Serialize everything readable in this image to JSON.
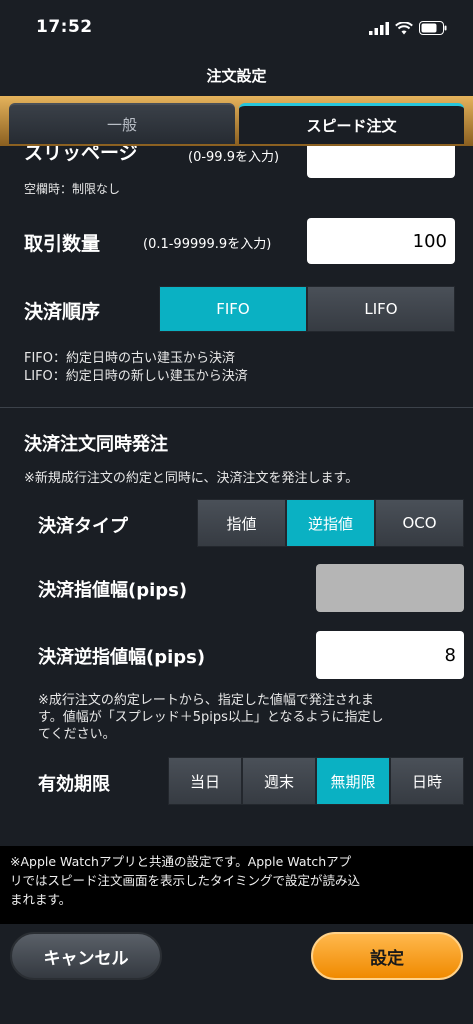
{
  "status": {
    "time": "17:52"
  },
  "title": "注文設定",
  "tabs": [
    {
      "label": "一般"
    },
    {
      "label": "スピード注文"
    }
  ],
  "slippage": {
    "label": "スリッページ",
    "hint": "(0-99.9を入力)",
    "note": "空欄時：制限なし",
    "value": ""
  },
  "quantity": {
    "label": "取引数量",
    "hint": "(0.1-99999.9を入力)",
    "value": "100"
  },
  "settlement_order": {
    "label": "決済順序",
    "options": [
      "FIFO",
      "LIFO"
    ],
    "selected": "FIFO",
    "notes": [
      "FIFO：約定日時の古い建玉から決済",
      "LIFO：約定日時の新しい建玉から決済"
    ]
  },
  "simultaneous": {
    "title": "決済注文同時発注",
    "note": "※新規成行注文の約定と同時に、決済注文を発注します。"
  },
  "settlement_type": {
    "label": "決済タイプ",
    "options": [
      "指値",
      "逆指値",
      "OCO"
    ],
    "selected": "逆指値"
  },
  "limit_width": {
    "label": "決済指値幅(pips)",
    "value": ""
  },
  "stop_width": {
    "label": "決済逆指値幅(pips)",
    "value": "8"
  },
  "width_note": [
    "※成行注文の約定レートから、指定した値幅で発注されま",
    "す。値幅が「スプレッド＋5pips以上」となるように指定し",
    "てください。"
  ],
  "expiry": {
    "label": "有効期限",
    "options": [
      "当日",
      "週末",
      "無期限",
      "日時"
    ],
    "selected": "無期限"
  },
  "footer_note": [
    "※Apple Watchアプリと共通の設定です。Apple Watchアプ",
    "リではスピード注文画面を表示したタイミングで設定が読み込",
    "まれます。"
  ],
  "buttons": {
    "cancel": "キャンセル",
    "ok": "設定"
  },
  "colors": {
    "accent": "#0ab1c3",
    "ok_button": "#f79a1e",
    "background": "#1a1e24"
  }
}
